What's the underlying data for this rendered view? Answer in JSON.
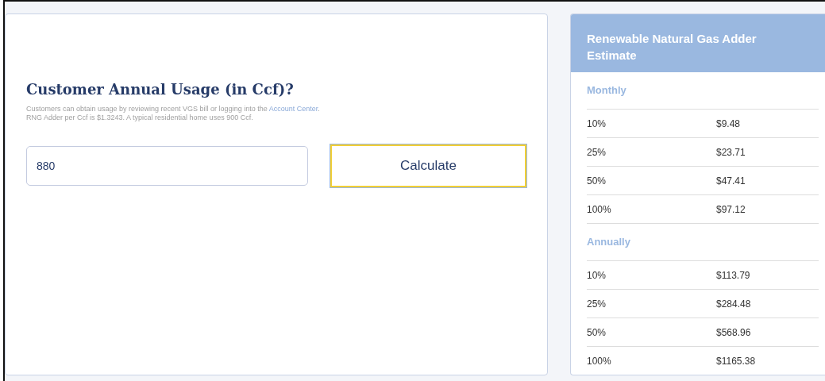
{
  "calculator": {
    "heading": "Customer Annual Usage (in Ccf)?",
    "help_lines": [
      {
        "before": "Customers can obtain usage by reviewing recent VGS bill or logging into the ",
        "link": "Account Center",
        "after": "."
      },
      {
        "before": "RNG Adder per Ccf is $1.3243. A typical residential home uses 900 Ccf."
      }
    ],
    "usage_field": {
      "value": "880"
    },
    "calculate_button": {
      "label": "Calculate",
      "focused": true
    }
  },
  "estimate": {
    "title": "Renewable Natural Gas Adder Estimate",
    "sections": [
      {
        "title": "Monthly",
        "rows": [
          {
            "percent": "10%",
            "amount": "$9.48"
          },
          {
            "percent": "25%",
            "amount": "$23.71"
          },
          {
            "percent": "50%",
            "amount": "$47.41"
          },
          {
            "percent": "100%",
            "amount": "$97.12"
          }
        ]
      },
      {
        "title": "Annually",
        "rows": [
          {
            "percent": "10%",
            "amount": "$113.79"
          },
          {
            "percent": "25%",
            "amount": "$284.48"
          },
          {
            "percent": "50%",
            "amount": "$568.96"
          },
          {
            "percent": "100%",
            "amount": "$1165.38"
          }
        ]
      }
    ]
  }
}
